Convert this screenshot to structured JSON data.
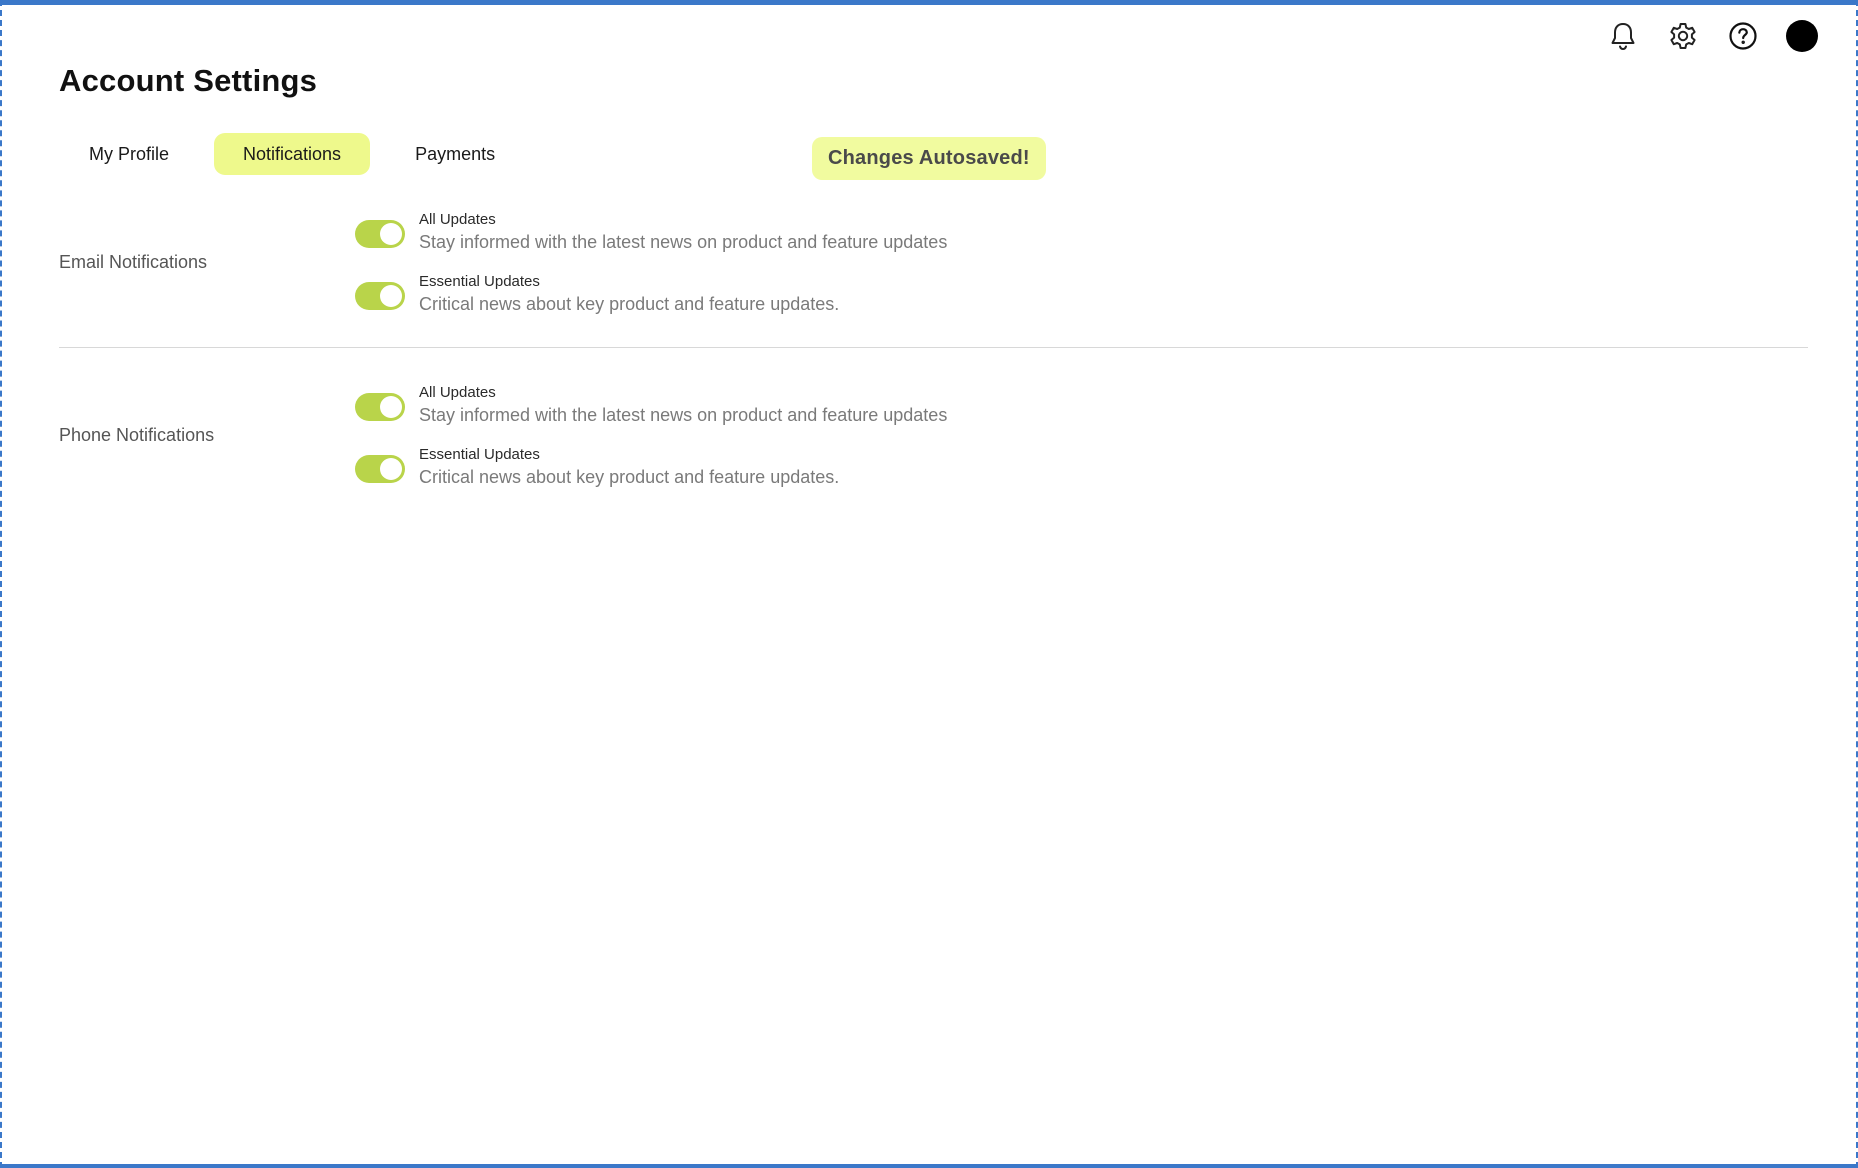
{
  "header": {
    "title": "Account Settings",
    "icons": [
      "bell-icon",
      "gear-icon",
      "help-icon",
      "avatar"
    ]
  },
  "tabs": [
    {
      "label": "My Profile",
      "active": false
    },
    {
      "label": "Notifications",
      "active": true
    },
    {
      "label": "Payments",
      "active": false
    }
  ],
  "autosave_badge": "Changes Autosaved!",
  "sections": [
    {
      "label": "Email Notifications",
      "options": [
        {
          "title": "All Updates",
          "description": "Stay informed with the latest news on product and feature updates",
          "enabled": true
        },
        {
          "title": "Essential Updates",
          "description": "Critical news about key product and feature updates.",
          "enabled": true
        }
      ]
    },
    {
      "label": "Phone Notifications",
      "options": [
        {
          "title": "All Updates",
          "description": "Stay informed with the latest news on product and feature updates",
          "enabled": true
        },
        {
          "title": "Essential Updates",
          "description": "Critical news about key product and feature updates.",
          "enabled": true
        }
      ]
    }
  ],
  "colors": {
    "accent": "#eef98c",
    "toggle_on": "#b9d44a",
    "frame_border": "#3b78c9"
  }
}
